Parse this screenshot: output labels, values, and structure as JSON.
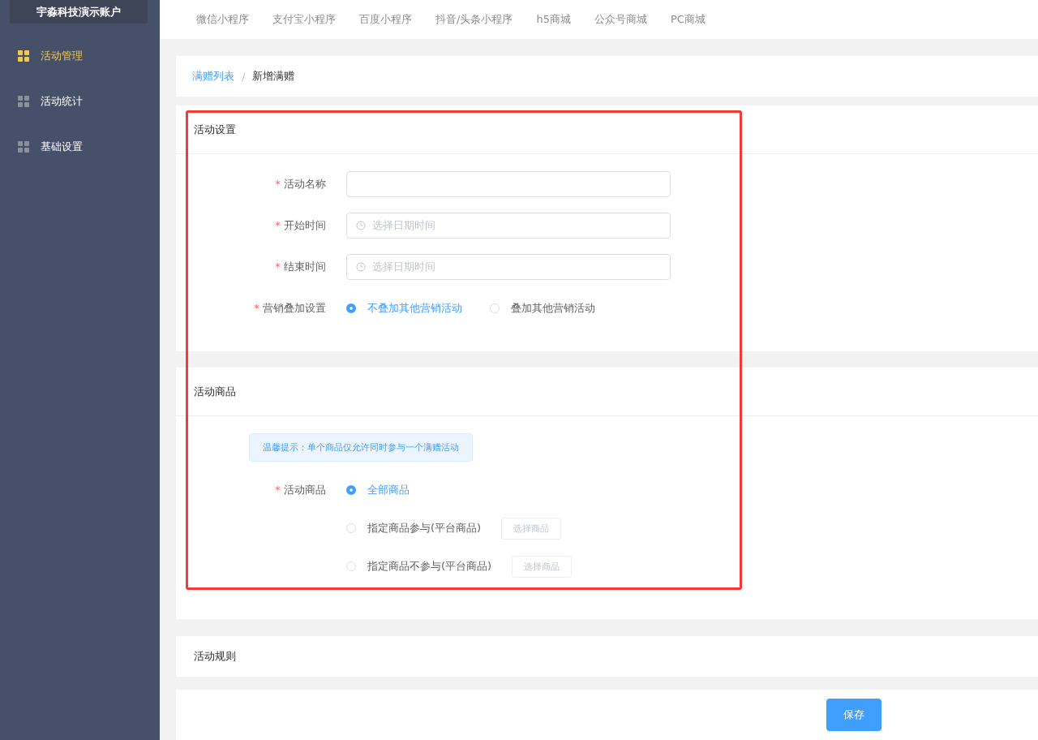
{
  "sidebar": {
    "account": "宇淼科技演示账户",
    "items": [
      {
        "label": "活动管理",
        "selected": true
      },
      {
        "label": "活动统计",
        "selected": false
      },
      {
        "label": "基础设置",
        "selected": false
      }
    ]
  },
  "top_tabs": [
    {
      "label": "微信小程序"
    },
    {
      "label": "支付宝小程序"
    },
    {
      "label": "百度小程序"
    },
    {
      "label": "抖音/头条小程序"
    },
    {
      "label": "h5商城"
    },
    {
      "label": "公众号商城"
    },
    {
      "label": "PC商城"
    }
  ],
  "breadcrumb": [
    {
      "label": "满赠列表",
      "kind": "link"
    },
    {
      "label": "/",
      "kind": "separator"
    },
    {
      "label": "新增满赠",
      "kind": "current"
    }
  ],
  "highlight_frame": true,
  "settings_section": {
    "title": "活动设置",
    "fields": [
      {
        "label": "活动名称",
        "required_mark": "*",
        "kind": "text"
      },
      {
        "label": "开始时间",
        "required_mark": "*",
        "kind": "datetime",
        "placeholder": "选择日期时间"
      },
      {
        "label": "结束时间",
        "required_mark": "*",
        "kind": "datetime",
        "placeholder": "选择日期时间"
      },
      {
        "label": "营销叠加设置",
        "required_mark": "*",
        "kind": "radio",
        "options": [
          {
            "label": "不叠加其他营销活动",
            "selected": true
          },
          {
            "label": "叠加其他营销活动",
            "selected": false
          }
        ]
      }
    ]
  },
  "goods_section": {
    "title": "活动商品",
    "tip": "温馨提示：单个商品仅允许同时参与一个满赠活动",
    "label": "活动商品",
    "required_mark": "*",
    "options": [
      {
        "label": "全部商品",
        "selected": true
      },
      {
        "label": "指定商品参与(平台商品)",
        "selected": false,
        "button": "选择商品"
      },
      {
        "label": "指定商品不参与(平台商品)",
        "selected": false,
        "button": "选择商品"
      }
    ]
  },
  "rules_section": {
    "title": "活动规则"
  },
  "save_button": "保存"
}
